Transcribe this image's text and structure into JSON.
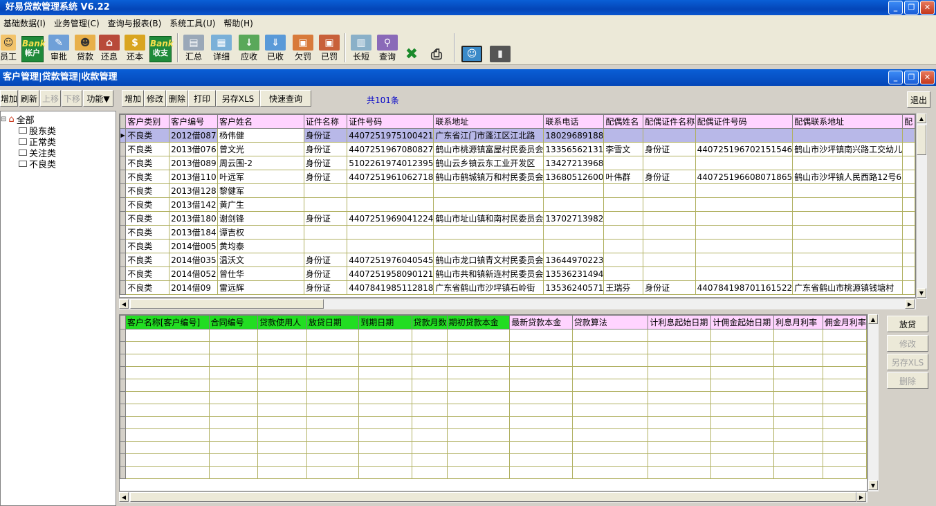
{
  "window": {
    "title": "好易贷款管理系统 V6.22"
  },
  "menu": [
    "基础数据(I)",
    "业务管理(C)",
    "查询与报表(B)",
    "系统工具(U)",
    "帮助(H)"
  ],
  "toolbar": {
    "employee": "员工",
    "bank_account": {
      "top": "Bank",
      "bottom": "帐户"
    },
    "approve": "审批",
    "loan": "贷款",
    "interest": "还息",
    "principal": "还本",
    "bank_income": {
      "top": "Bank",
      "bottom": "收支"
    },
    "summary": "汇总",
    "detail": "详细",
    "receivable": "应收",
    "received": "已收",
    "owe_fine": "欠罚",
    "fined": "已罚",
    "long_short": "长短",
    "query": "查询"
  },
  "subwindow": {
    "title": "客户管理|贷款管理|收款管理"
  },
  "left_buttons": {
    "add": "增加",
    "refresh": "刷新",
    "up": "上移",
    "down": "下移",
    "func": "功能▼"
  },
  "tree": {
    "root": "全部",
    "items": [
      "股东类",
      "正常类",
      "关注类",
      "不良类"
    ]
  },
  "main_buttons": {
    "add": "增加",
    "edit": "修改",
    "delete": "删除",
    "print": "打印",
    "export": "另存XLS",
    "quick_query": "快速查询",
    "exit": "退出"
  },
  "record_count": "共101条",
  "customer_table": {
    "headers": [
      "客户类别",
      "客户编号",
      "客户姓名",
      "证件名称",
      "证件号码",
      "联系地址",
      "联系电话",
      "配偶姓名",
      "配偶证件名称",
      "配偶证件号码",
      "配偶联系地址",
      "配"
    ],
    "rows": [
      [
        "不良类",
        "2012借087",
        "杨伟健",
        "身份证",
        "4407251975100421",
        "广东省江门市蓬江区江北路",
        "18029689188",
        "",
        "",
        "",
        "",
        ""
      ],
      [
        "不良类",
        "2013借076",
        "曾文光",
        "身份证",
        "4407251967080827",
        "鹤山市桃源镇富屋村民委员会",
        "13356562131",
        "李雪文",
        "身份证",
        "440725196702151546",
        "鹤山市沙坪镇南兴路工交幼儿",
        ""
      ],
      [
        "不良类",
        "2013借089",
        "周云围-2",
        "身份证",
        "5102261974012395",
        "鹤山云乡镇云东工业开发区",
        "13427213968",
        "",
        "",
        "",
        "",
        ""
      ],
      [
        "不良类",
        "2013借110",
        "叶远军",
        "身份证",
        "4407251961062718",
        "鹤山市鹤城镇万和村民委员会",
        "13680512600",
        "叶伟群",
        "身份证",
        "440725196608071865",
        "鹤山市沙坪镇人民西路12号6",
        ""
      ],
      [
        "不良类",
        "2013借128",
        "黎健军",
        "",
        "",
        "",
        "",
        "",
        "",
        "",
        "",
        ""
      ],
      [
        "不良类",
        "2013借142",
        "黄广生",
        "",
        "",
        "",
        "",
        "",
        "",
        "",
        "",
        ""
      ],
      [
        "不良类",
        "2013借180",
        "谢剑锋",
        "身份证",
        "4407251969041224",
        "鹤山市址山镇和南村民委员会",
        "13702713982",
        "",
        "",
        "",
        "",
        ""
      ],
      [
        "不良类",
        "2013借184",
        "谭吉权",
        "",
        "",
        "",
        "",
        "",
        "",
        "",
        "",
        ""
      ],
      [
        "不良类",
        "2014借005",
        "黄均泰",
        "",
        "",
        "",
        "",
        "",
        "",
        "",
        "",
        ""
      ],
      [
        "不良类",
        "2014借035",
        "温沃文",
        "身份证",
        "4407251976040545",
        "鹤山市龙口镇青文村民委员会",
        "13644970223",
        "",
        "",
        "",
        "",
        ""
      ],
      [
        "不良类",
        "2014借052",
        "曾仕华",
        "身份证",
        "4407251958090121",
        "鹤山市共和镇新连村民委员会",
        "13536231494",
        "",
        "",
        "",
        "",
        ""
      ],
      [
        "不良类",
        "2014借09",
        "雷远辉",
        "身份证",
        "4407841985112818",
        "广东省鹤山市沙坪镇石岭街",
        "13536240571",
        "王瑞芬",
        "身份证",
        "440784198701161522",
        "广东省鹤山市桃源镇钱塘村",
        ""
      ]
    ]
  },
  "loan_table": {
    "headers": [
      "客户名称[客户编号]",
      "合同编号",
      "贷款使用人",
      "放贷日期",
      "到期日期",
      "贷款月数",
      "期初贷款本金",
      "最新贷款本金",
      "贷款算法",
      "计利息起始日期",
      "计佣金起始日期",
      "利息月利率",
      "佣金月利率"
    ]
  },
  "loan_buttons": {
    "lend": "放贷",
    "edit": "修改",
    "export": "另存XLS",
    "delete": "删除"
  }
}
